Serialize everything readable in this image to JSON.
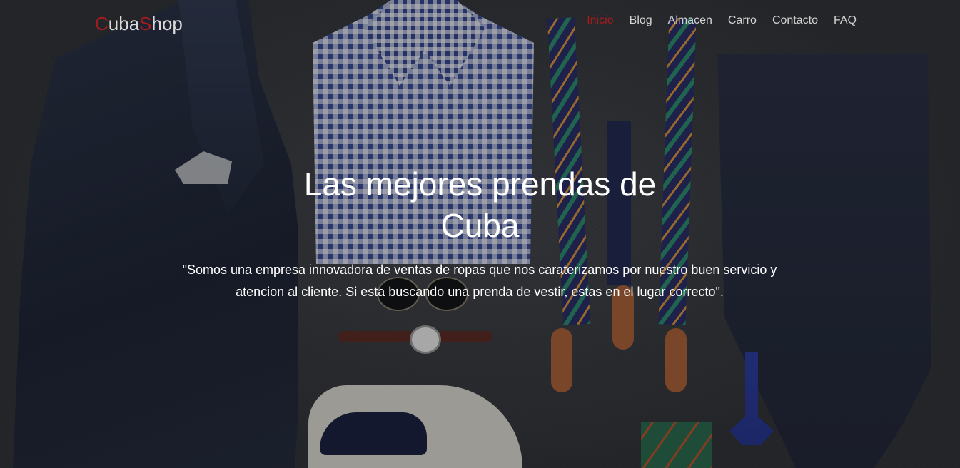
{
  "brand": {
    "letter_c": "C",
    "part_uba": "uba",
    "letter_s": "S",
    "part_hop": "hop",
    "accent_color": "#a51c1c"
  },
  "nav": {
    "items": [
      {
        "label": "Inicio",
        "active": true
      },
      {
        "label": "Blog"
      },
      {
        "label": "Almacen"
      },
      {
        "label": "Carro"
      },
      {
        "label": "Contacto"
      },
      {
        "label": "FAQ"
      }
    ]
  },
  "hero": {
    "title": "Las mejores prendas de Cuba",
    "description": "\"Somos una empresa innovadora de ventas de ropas que nos caraterizamos por nuestro buen servicio y atencion al cliente. Si esta buscando una prenda de vestir, estas en el lugar correcto\"."
  }
}
